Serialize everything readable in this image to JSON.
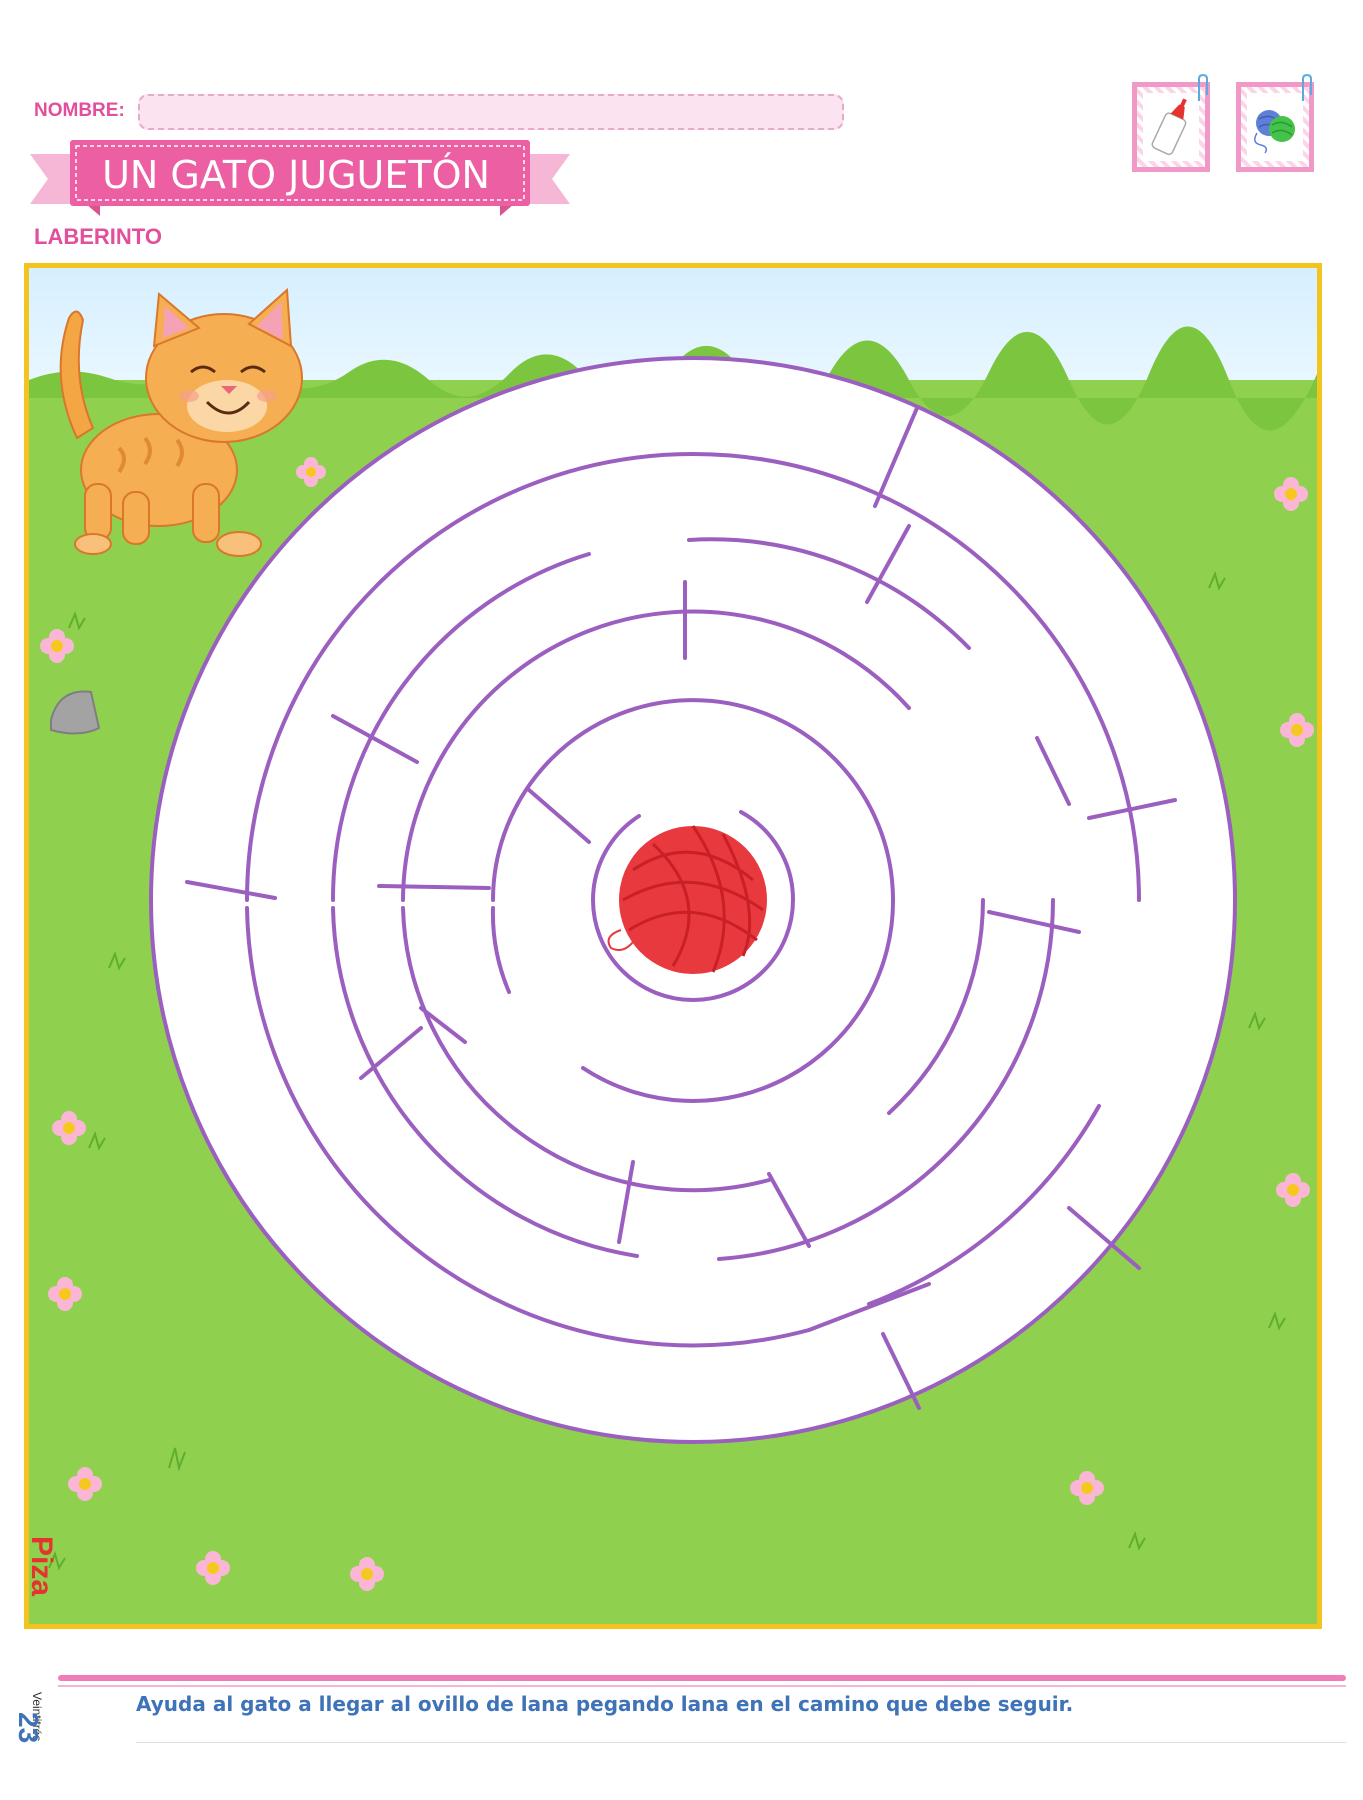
{
  "header": {
    "name_label": "NOMBRE:",
    "name_value": "",
    "title": "UN GATO JUGUETÓN",
    "subtitle": "LABERINTO"
  },
  "materials": [
    {
      "icon": "glue-bottle-icon"
    },
    {
      "icon": "yarn-balls-icon"
    }
  ],
  "illustration": {
    "elements": [
      "kitten",
      "yarn-ball",
      "circular-maze",
      "flowers",
      "grass"
    ],
    "colors": {
      "frame": "#f3c31e",
      "maze_walls": "#9b5fc0",
      "grass": "#8fd14f",
      "sky": "#d6efff",
      "yarn": "#e8393f"
    }
  },
  "footer": {
    "page_number": "23",
    "page_word": "Veintitrés",
    "instruction": "Ayuda al gato a llegar al ovillo de lana pegando lana en el camino que debe seguir.",
    "publisher": "Piza"
  }
}
